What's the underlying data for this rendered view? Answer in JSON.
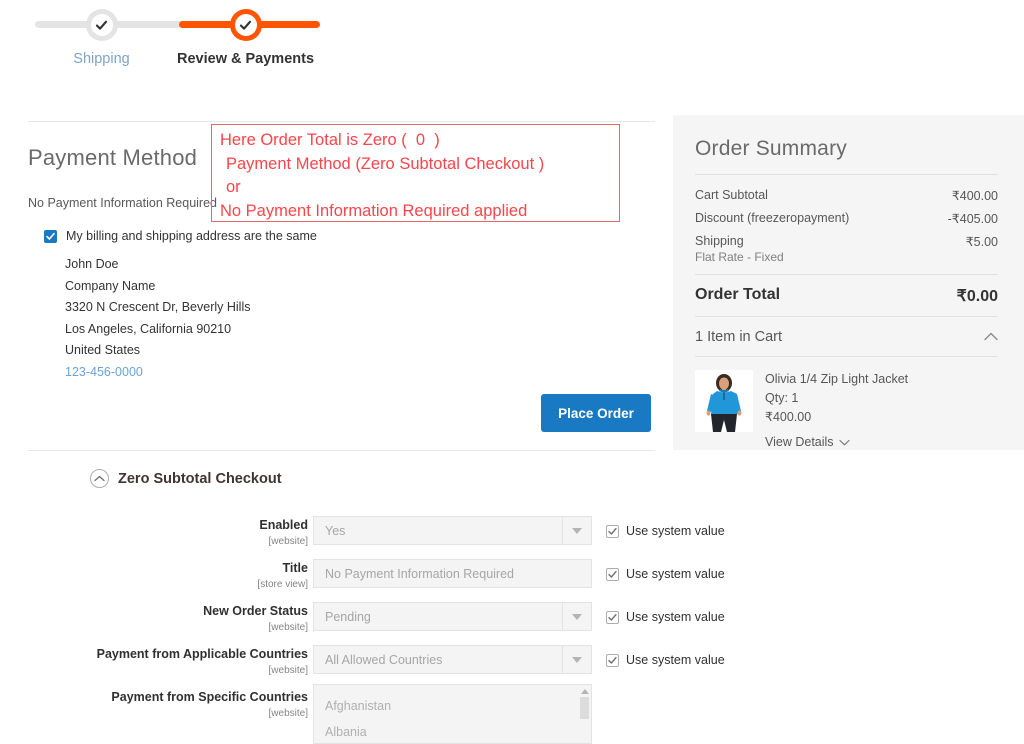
{
  "checkout_progress": {
    "steps": [
      {
        "label": "Shipping",
        "state": "complete",
        "icon": "check-icon"
      },
      {
        "label": "Review & Payments",
        "state": "current",
        "icon": "check-icon"
      }
    ]
  },
  "payment_method": {
    "heading": "Payment Method",
    "method_name": "No Payment Information Required",
    "same_address_label": "My billing and shipping address are the same",
    "same_address_checked": true,
    "address": [
      "John Doe",
      "Company Name",
      "3320 N Crescent Dr, Beverly Hills",
      "Los Angeles, California 90210",
      "United States"
    ],
    "phone": "123-456-0000",
    "place_order_label": "Place Order"
  },
  "annotation": {
    "line1": "Here Order Total is Zero (  0  )",
    "line2": "Payment Method (Zero Subtotal Checkout )",
    "line3": "or",
    "line4": "No Payment Information Required applied",
    "border_color": "#e8656a",
    "text_color": "#f9454b"
  },
  "order_summary": {
    "title": "Order Summary",
    "rows": [
      {
        "label": "Cart Subtotal",
        "sub": "",
        "value": "₹400.00"
      },
      {
        "label": "Discount (freezeropayment)",
        "sub": "",
        "value": "-₹405.00"
      },
      {
        "label": "Shipping",
        "sub": "Flat Rate - Fixed",
        "value": "₹5.00"
      }
    ],
    "grand_total": {
      "label": "Order Total",
      "value": "₹0.00"
    },
    "cart_header": "1 Item in Cart",
    "cart_collapse_icon": "chevron-up-icon",
    "item": {
      "name": "Olivia 1/4 Zip Light Jacket",
      "qty_label": "Qty: 1",
      "price": "₹400.00",
      "view_details_label": "View Details",
      "view_details_icon": "chevron-down-icon"
    }
  },
  "admin_section": {
    "title": "Zero Subtotal Checkout",
    "collapse_icon": "chevron-up-circle-icon",
    "use_system_value_label": "Use system value",
    "fields": [
      {
        "label": "Enabled",
        "scope": "[website]",
        "type": "select",
        "value": "Yes",
        "use_system_value": true
      },
      {
        "label": "Title",
        "scope": "[store view]",
        "type": "text",
        "value": "No Payment Information Required",
        "use_system_value": true
      },
      {
        "label": "New Order Status",
        "scope": "[website]",
        "type": "select",
        "value": "Pending",
        "use_system_value": true
      },
      {
        "label": "Payment from Applicable Countries",
        "scope": "[website]",
        "type": "select",
        "value": "All Allowed Countries",
        "use_system_value": true
      },
      {
        "label": "Payment from Specific Countries",
        "scope": "[website]",
        "type": "multiselect",
        "options": [
          "Afghanistan",
          "Albania"
        ],
        "use_system_value": false
      }
    ]
  },
  "colors": {
    "accent_orange": "#ff5501",
    "primary_blue": "#1979c3",
    "panel_gray": "#f5f5f5"
  }
}
